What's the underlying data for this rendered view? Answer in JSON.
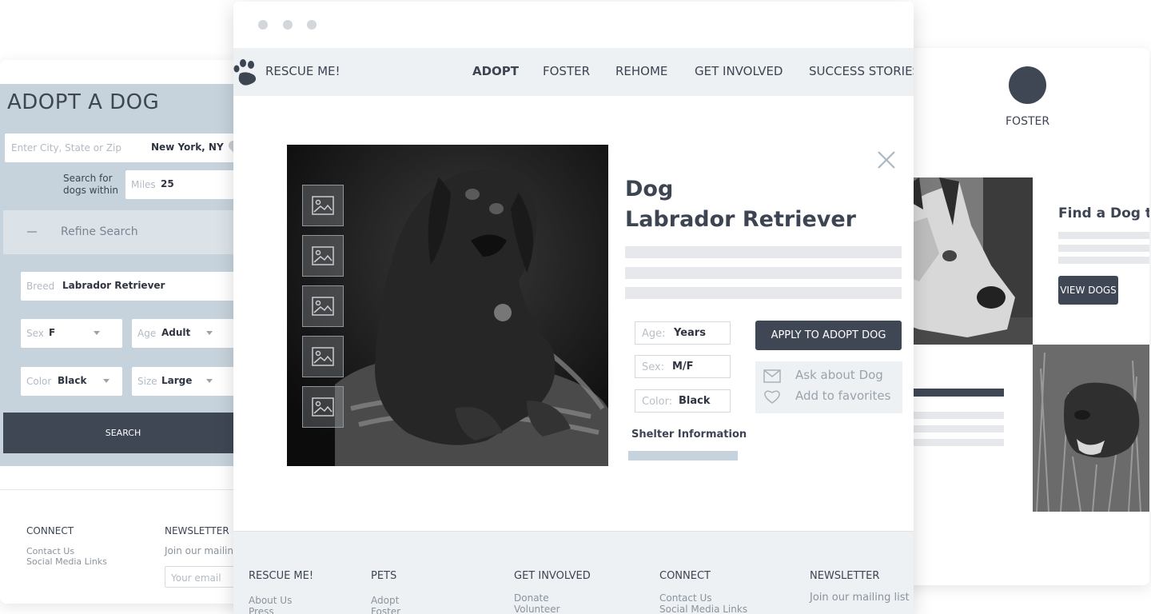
{
  "left_card": {
    "title": "ADOPT A DOG",
    "location": {
      "placeholder": "Enter City, State or Zip",
      "value": "New York, NY"
    },
    "within_label_line1": "Search for",
    "within_label_line2": "dogs within",
    "miles": {
      "placeholder": "Miles",
      "value": "25"
    },
    "refine_label": "Refine Search",
    "breed": {
      "placeholder": "Breed",
      "value": "Labrador Retriever"
    },
    "sex": {
      "placeholder": "Sex",
      "value": "F"
    },
    "age": {
      "placeholder": "Age",
      "value": "Adult"
    },
    "color": {
      "placeholder": "Color",
      "value": "Black"
    },
    "size": {
      "placeholder": "Size",
      "value": "Large"
    },
    "search_button": "SEARCH",
    "footer": {
      "connect_heading": "CONNECT",
      "connect_links": [
        "Contact Us",
        "Social Media Links"
      ],
      "newsletter_heading": "NEWSLETTER",
      "newsletter_text": "Join our mailin",
      "email_placeholder": "Your email"
    }
  },
  "main": {
    "brand": "RESCUE ME!",
    "nav": [
      "ADOPT",
      "FOSTER",
      "REHOME",
      "GET INVOLVED",
      "SUCCESS STORIES"
    ],
    "active_nav": "ADOPT",
    "dog": {
      "title_line1": "Dog",
      "title_line2": "Labrador Retriever",
      "age_label": "Age:",
      "age_value": "Years",
      "sex_label": "Sex:",
      "sex_value": "M/F",
      "color_label": "Color:",
      "color_value": "Black",
      "apply_button": "APPLY TO ADOPT DOG",
      "ask_label": "Ask about Dog",
      "favorites_label": "Add to favorites",
      "shelter_label": "Shelter Information"
    },
    "footer": {
      "col1": {
        "heading": "RESCUE ME!",
        "links": [
          "About Us",
          "Press"
        ]
      },
      "col2": {
        "heading": "PETS",
        "links": [
          "Adopt",
          "Foster"
        ]
      },
      "col3": {
        "heading": "GET INVOLVED",
        "links": [
          "Donate",
          "Volunteer"
        ]
      },
      "col4": {
        "heading": "CONNECT",
        "links": [
          "Contact Us",
          "Social Media Links"
        ]
      },
      "col5": {
        "heading": "NEWSLETTER",
        "links": [
          "Join our mailing list"
        ]
      }
    }
  },
  "right_card": {
    "foster_label": "FOSTER",
    "find_heading": "Find a Dog to",
    "view_button": "VIEW DOGS"
  },
  "colors": {
    "accent_dark": "#3f4755",
    "search_panel": "#c7d3dc",
    "nav_bg": "#edf1f4"
  }
}
